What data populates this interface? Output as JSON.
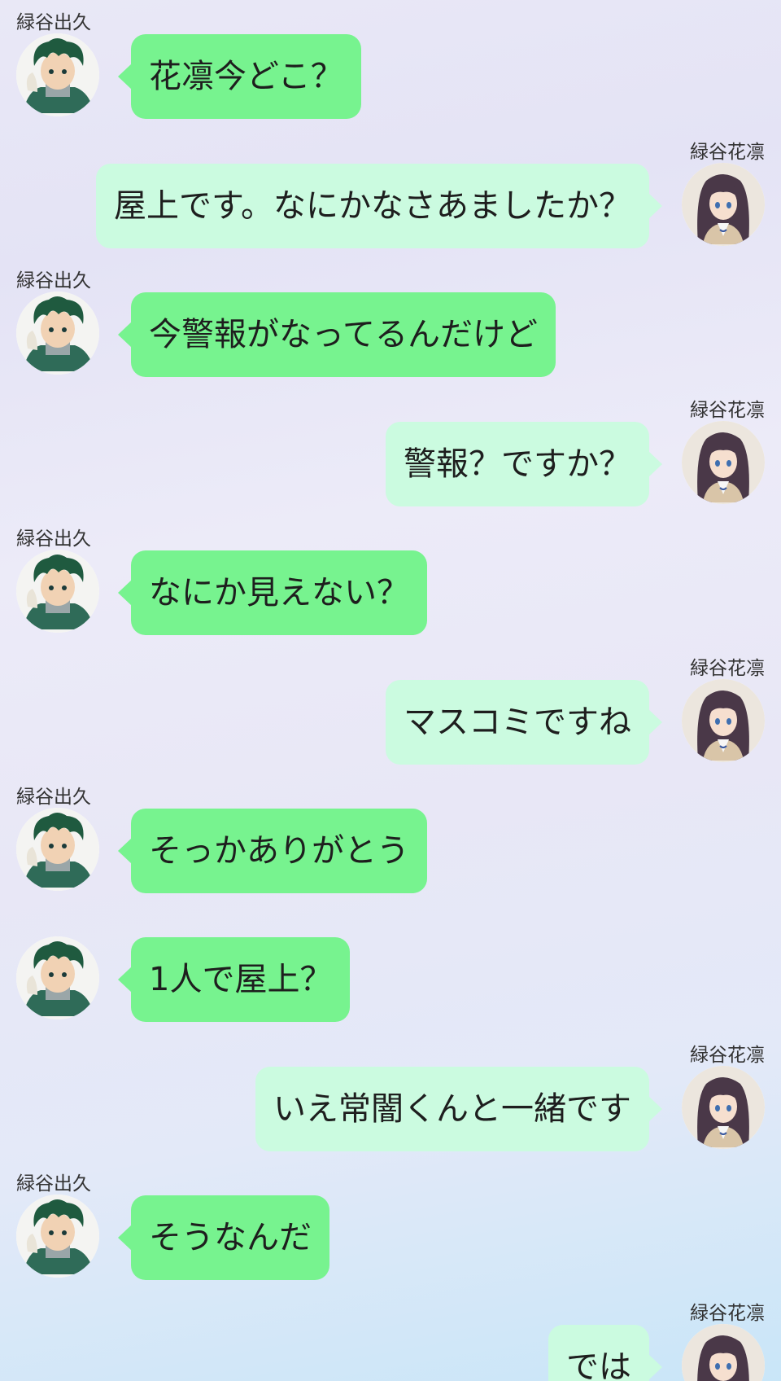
{
  "participants": {
    "left": {
      "name": "緑谷出久",
      "avatar_icon": "green-haired-boy-avatar"
    },
    "right": {
      "name": "緑谷花凛",
      "avatar_icon": "long-haired-girl-avatar"
    }
  },
  "colors": {
    "left_bubble": "#77f38f",
    "right_bubble": "#cbfbe0",
    "text": "#1e1e1e"
  },
  "messages": [
    {
      "side": "left",
      "sender": "緑谷出久",
      "text": "花凛今どこ？"
    },
    {
      "side": "right",
      "sender": "緑谷花凛",
      "text": "屋上です。なにかなさあましたか？"
    },
    {
      "side": "left",
      "sender": "緑谷出久",
      "text": "今警報がなってるんだけど"
    },
    {
      "side": "right",
      "sender": "緑谷花凛",
      "text": "警報？ですか？"
    },
    {
      "side": "left",
      "sender": "緑谷出久",
      "text": "なにか見えない？"
    },
    {
      "side": "right",
      "sender": "緑谷花凛",
      "text": "マスコミですね"
    },
    {
      "side": "left",
      "sender": "緑谷出久",
      "text": "そっかありがとう"
    },
    {
      "side": "left",
      "sender": "",
      "text": "1人で屋上？"
    },
    {
      "side": "right",
      "sender": "緑谷花凛",
      "text": "いえ常闇くんと一緒です"
    },
    {
      "side": "left",
      "sender": "緑谷出久",
      "text": "そうなんだ"
    },
    {
      "side": "right",
      "sender": "緑谷花凛",
      "text": "では"
    }
  ]
}
